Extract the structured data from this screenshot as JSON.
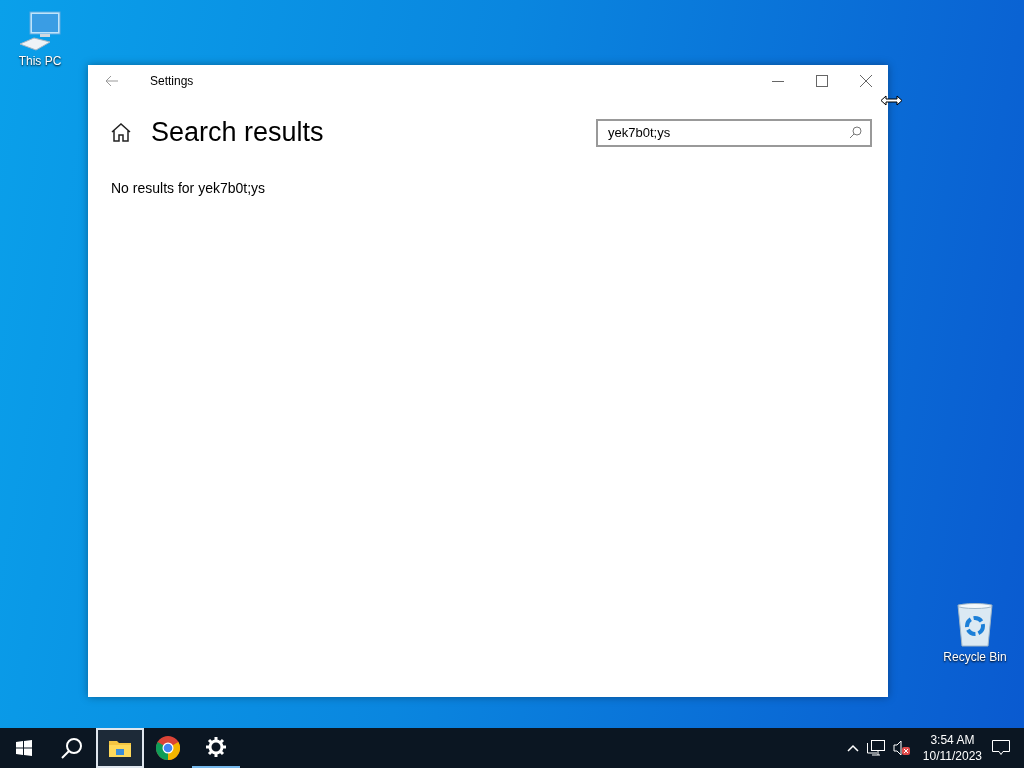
{
  "desktop_icons": [
    {
      "kind": "computer",
      "label": "This PC"
    },
    {
      "kind": "recycle",
      "label": "Recycle Bin"
    }
  ],
  "window": {
    "title": "Settings",
    "heading": "Search results",
    "search": {
      "value": "yek7b0t;ys"
    },
    "message": "No results for yek7b0t;ys"
  },
  "taskbar": {
    "apps": [
      {
        "kind": "explorer",
        "selected": true,
        "running": false
      },
      {
        "kind": "chrome",
        "selected": false,
        "running": false
      },
      {
        "kind": "settings",
        "selected": false,
        "running": true
      }
    ],
    "clock": {
      "time": "3:54 AM",
      "date": "10/11/2023"
    }
  }
}
